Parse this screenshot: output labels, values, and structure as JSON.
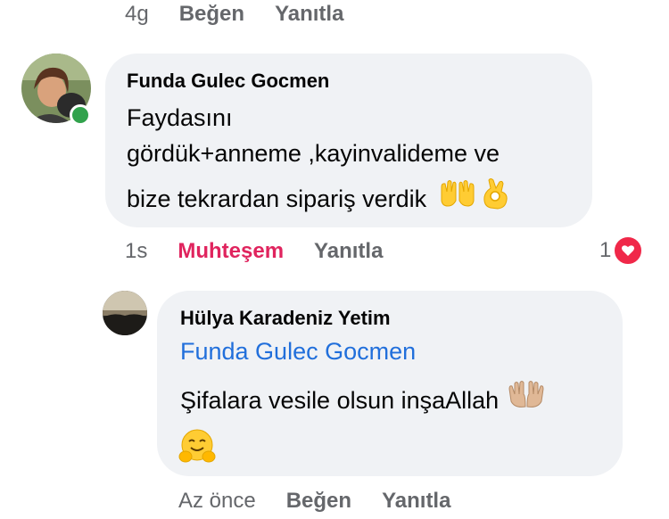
{
  "top_meta": {
    "time": "4g",
    "like": "Beğen",
    "reply": "Yanıtla"
  },
  "comment1": {
    "author": "Funda Gulec Gocmen",
    "line1": "Faydasını",
    "line2": "gördük+anneme ,kayinvalideme ve",
    "line3": "bize tekrardan sipariş verdik",
    "emojis": [
      "raising-hands-icon",
      "ok-hand-icon"
    ],
    "time": "1s",
    "reaction_label": "Muhteşem",
    "reply": "Yanıtla",
    "reaction_count": "1",
    "online": true
  },
  "comment2": {
    "author": "Hülya Karadeniz Yetim",
    "mention": "Funda Gulec Gocmen",
    "text": "Şifalara vesile olsun inşaAllah",
    "emojis": [
      "palms-up-together-icon",
      "hugging-face-icon"
    ],
    "time": "Az önce",
    "like": "Beğen",
    "reply": "Yanıtla"
  },
  "colors": {
    "bubble": "#f0f2f5",
    "meta": "#65676b",
    "reaction": "#e0245e",
    "mention": "#216fdb",
    "online": "#31a24c",
    "heart_badge": "#f02849"
  }
}
